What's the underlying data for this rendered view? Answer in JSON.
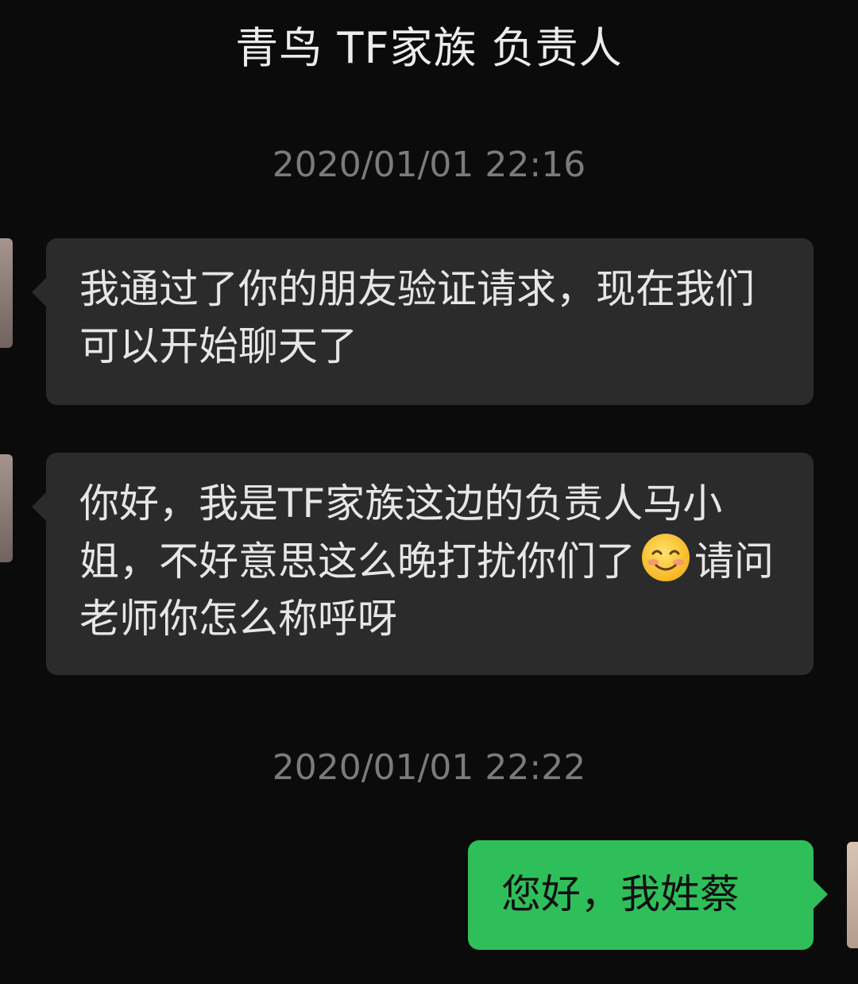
{
  "header": {
    "title": "青鸟 TF家族 负责人"
  },
  "messages": [
    {
      "timestamp": "2020/01/01 22:16"
    },
    {
      "direction": "in",
      "text": "我通过了你的朋友验证请求，现在我们可以开始聊天了"
    },
    {
      "direction": "in",
      "text_before_emoji": "你好，我是TF家族这边的负责人马小姐，不好意思这么晚打扰你们了",
      "emoji": "smiling-face-icon",
      "text_after_emoji": "请问老师你怎么称呼呀"
    },
    {
      "timestamp": "2020/01/01 22:22"
    },
    {
      "direction": "out",
      "text": "您好，我姓蔡"
    }
  ],
  "colors": {
    "background": "#0b0b0b",
    "incoming_bubble": "#2b2b2b",
    "outgoing_bubble": "#2fbf5a",
    "timestamp_text": "#7b7b7b"
  }
}
